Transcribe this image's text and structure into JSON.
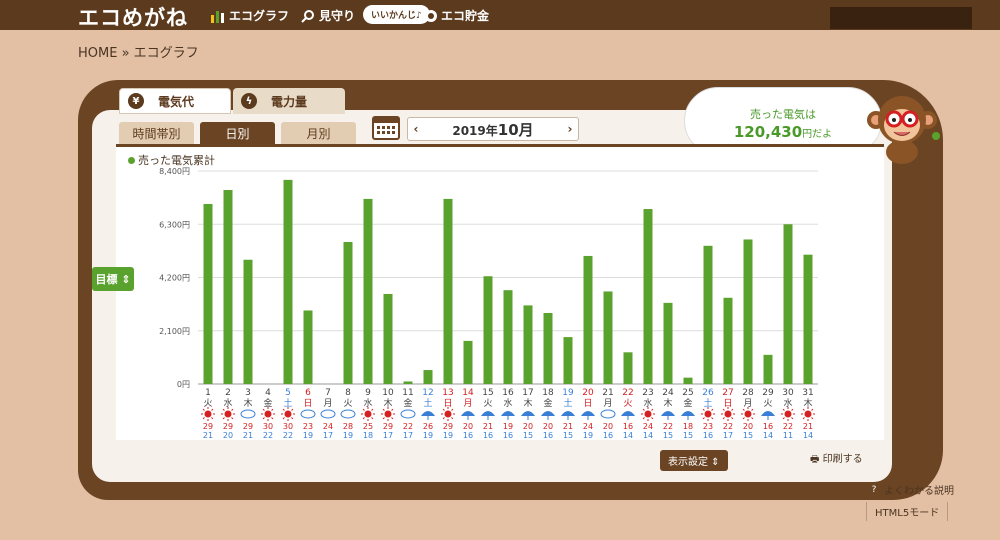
{
  "header": {
    "logo": "エコめがね",
    "nav": [
      {
        "label": "エコグラフ",
        "icon": "bar-chart-icon"
      },
      {
        "label": "見守り",
        "icon": "magnifier-icon"
      },
      {
        "label": "エコ貯金",
        "icon": "coin-icon"
      }
    ],
    "badge": "いいかんじ♪"
  },
  "breadcrumb": "HOME » エコグラフ",
  "tabs_top": [
    {
      "label": "電気代",
      "icon": "yen-icon"
    },
    {
      "label": "電力量",
      "icon": "lightning-icon"
    }
  ],
  "subtabs": [
    "時間帯別",
    "日別",
    "月別"
  ],
  "month_nav": {
    "year_prefix": "2019年",
    "month": "10月"
  },
  "bubble": {
    "line1": "売った電気は",
    "amount": "120,430",
    "suffix": "円だよ"
  },
  "legend": "売った電気累計",
  "goal_button": "目標 ⇕",
  "display_settings": "表示設定 ⇕",
  "print": "印刷する",
  "help": "よくわかる説明",
  "html5": "HTML5モード",
  "colors": {
    "bar": "#5aa22e",
    "sat": "#3a7fd5",
    "sun": "#d42020",
    "weekday": "#444444"
  },
  "chart_data": {
    "type": "bar",
    "ylim": [
      0,
      8400
    ],
    "yticks": [
      "0円",
      "2,100円",
      "4,200円",
      "6,300円",
      "8,400円"
    ],
    "days": [
      "1",
      "2",
      "3",
      "4",
      "5",
      "6",
      "7",
      "8",
      "9",
      "10",
      "11",
      "12",
      "13",
      "14",
      "15",
      "16",
      "17",
      "18",
      "19",
      "20",
      "21",
      "22",
      "23",
      "24",
      "25",
      "26",
      "27",
      "28",
      "29",
      "30",
      "31"
    ],
    "weekdays": [
      "火",
      "水",
      "木",
      "金",
      "土",
      "日",
      "月",
      "火",
      "水",
      "木",
      "金",
      "土",
      "日",
      "月",
      "火",
      "水",
      "木",
      "金",
      "土",
      "日",
      "月",
      "火",
      "水",
      "木",
      "金",
      "土",
      "日",
      "月",
      "火",
      "水",
      "木"
    ],
    "day_types": [
      "w",
      "w",
      "w",
      "w",
      "sat",
      "sun",
      "w",
      "w",
      "w",
      "w",
      "w",
      "sat",
      "sun",
      "sun",
      "w",
      "w",
      "w",
      "w",
      "sat",
      "sun",
      "w",
      "sun",
      "w",
      "w",
      "w",
      "sat",
      "sun",
      "w",
      "w",
      "w",
      "w"
    ],
    "values": [
      7100,
      7650,
      4900,
      0,
      8050,
      2900,
      0,
      5600,
      7300,
      3550,
      100,
      550,
      7300,
      1700,
      4250,
      3700,
      3100,
      2800,
      1850,
      5050,
      3650,
      1250,
      6900,
      3200,
      250,
      5450,
      3400,
      5700,
      1150,
      6300,
      5100
    ],
    "weather": [
      "sun",
      "sun",
      "cloud",
      "sun",
      "sun",
      "cloud",
      "cloud",
      "cloud",
      "sun",
      "sun",
      "cloud",
      "rain",
      "sun",
      "rain",
      "rain",
      "rain",
      "rain",
      "rain",
      "rain",
      "rain",
      "cloud",
      "rain",
      "sun",
      "rain",
      "rain",
      "sun",
      "sun",
      "sun",
      "rain",
      "sun",
      "sun"
    ],
    "high_temps": [
      "29",
      "29",
      "29",
      "30",
      "30",
      "23",
      "24",
      "28",
      "25",
      "29",
      "22",
      "26",
      "29",
      "20",
      "21",
      "19",
      "20",
      "20",
      "21",
      "24",
      "20",
      "16",
      "24",
      "22",
      "18",
      "23",
      "22",
      "20",
      "16",
      "22",
      "21"
    ],
    "low_temps": [
      "21",
      "20",
      "21",
      "22",
      "22",
      "19",
      "17",
      "19",
      "18",
      "17",
      "17",
      "19",
      "19",
      "16",
      "16",
      "16",
      "15",
      "16",
      "15",
      "19",
      "16",
      "14",
      "14",
      "15",
      "15",
      "16",
      "17",
      "15",
      "14",
      "11",
      "14"
    ]
  }
}
